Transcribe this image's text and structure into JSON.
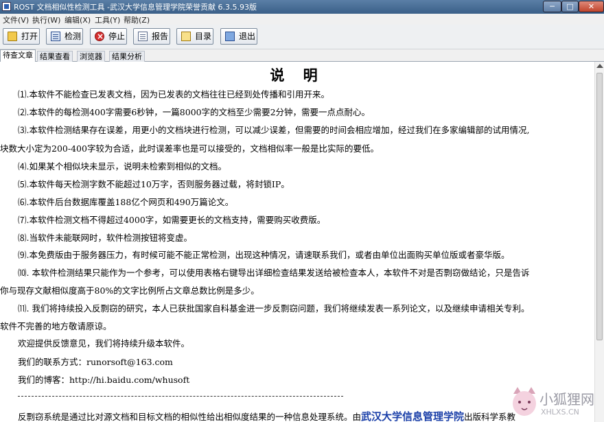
{
  "window": {
    "title": "ROST 文档相似性检测工具 -武汉大学信息管理学院荣誉贡献 6.3.5.93版",
    "controls": {
      "minimize": "─",
      "maximize": "□",
      "close": "✕"
    }
  },
  "menu": [
    "文件(V)",
    "执行(W)",
    "编辑(X)",
    "工具(Y)",
    "帮助(Z)"
  ],
  "toolbar": {
    "open": "打开",
    "detect": "检测",
    "stop": "停止",
    "report": "报告",
    "catalog": "目录",
    "exit": "退出"
  },
  "tabs": [
    "待查文章",
    "结果查看",
    "浏览器",
    "结果分析"
  ],
  "content": {
    "heading": "说 明",
    "lines": [
      "⑴.本软件不能检查已发表文档，因为已发表的文档往往已经到处传播和引用开来。",
      "⑵.本软件的每检测400字需要6秒钟，一篇8000字的文档至少需要2分钟，需要一点点耐心。",
      "⑶.本软件检测结果存在误差，用更小的文档块进行检测，可以减少误差，但需要的时间会相应增加，经过我们在多家编辑部的试用情况,",
      "块数大小定为200-400字较为合适，此时误差率也是可以接受的，文档相似率一般是比实际的要低。",
      "⑷.如果某个相似块未显示，说明未检索到相似的文档。",
      "⑸.本软件每天检测字数不能超过10万字，否则服务器过载，将封锁IP。",
      "⑹.本软件后台数据库覆盖188亿个网页和490万篇论文。",
      "⑺.本软件检测文档不得超过4000字，如需要更长的文档支持，需要购买收费版。",
      "⑻.当软件未能联网时，软件检测按钮将变虚。",
      "⑼.本免费版由于服务器压力，有时候可能不能正常检测，出现这种情况，请速联系我们，或者由单位出面购买单位版或者豪华版。",
      "⑽. 本软件检测结果只能作为一个参考，可以使用表格右键导出详细检查结果发送给被检查本人，本软件不对是否剽窃做结论，只是告诉",
      "你与现存文献相似度高于80%的文字比例所占文章总数比例是多少。",
      "⑾. 我们将持续投入反剽窃的研究，本人已获批国家自科基金进一步反剽窃问题，我们将继续发表一系列论文，以及继续申请相关专利。",
      "软件不完善的地方敬请原谅。",
      "欢迎提供反馈意见，我们将持续升级本软件。",
      "我们的联系方式：runorsoft@163.com",
      "我们的博客：http://hi.baidu.com/whusoft"
    ],
    "last_line": {
      "before": "反剽窃系统是通过比对源文档和目标文档的相似性给出相似度结果的一种信息处理系统。由",
      "link": "武汉大学信息管理学院",
      "after": "出版科学系教"
    }
  },
  "watermark": {
    "text": "小狐狸网",
    "url": "XHLXS.CN"
  }
}
